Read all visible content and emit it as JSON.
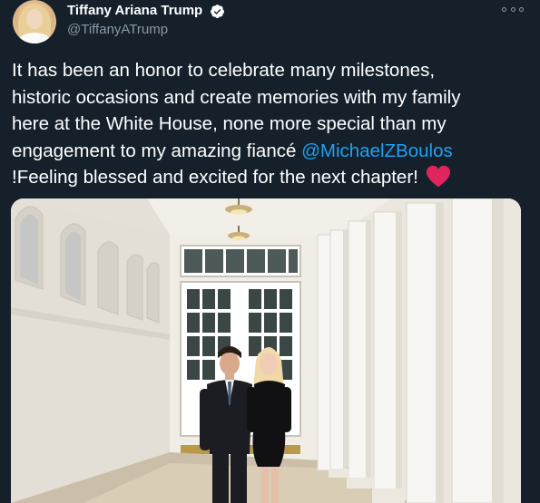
{
  "author": {
    "display_name": "Tiffany Ariana Trump",
    "handle": "@TiffanyATrump",
    "verified": true,
    "avatar_icon": "profile-photo",
    "verified_icon": "verified-badge-icon"
  },
  "menu": {
    "icon": "more-options-icon"
  },
  "tweet": {
    "text_line_1": "It has been an honor to celebrate many milestones,",
    "text_line_2": "historic occasions and create memories with my family",
    "text_line_3": "here at the White House, none more special than my",
    "text_line_4_prefix": "engagement to my amazing fiancé ",
    "mention": "@MichaelZBoulos",
    "text_line_5": "!Feeling blessed and excited for the next chapter!",
    "emoji_icon": "red-heart-icon"
  },
  "colors": {
    "background": "#15202b",
    "text": "#ffffff",
    "secondary_text": "#8899a6",
    "link": "#1da1f2",
    "verified": "#1da1f2",
    "heart": "#e0245e"
  },
  "media": {
    "type": "photo",
    "icon": "attached-photo"
  }
}
